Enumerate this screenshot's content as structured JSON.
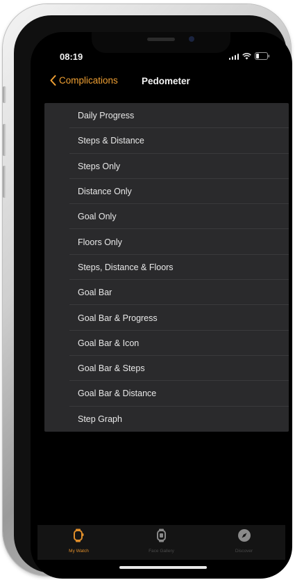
{
  "status_bar": {
    "time": "08:19"
  },
  "nav": {
    "back_label": "Complications",
    "title": "Pedometer",
    "accent": "#f0a033"
  },
  "list": {
    "items": [
      {
        "label": "Daily Progress"
      },
      {
        "label": "Steps & Distance"
      },
      {
        "label": "Steps Only"
      },
      {
        "label": "Distance Only"
      },
      {
        "label": "Goal Only"
      },
      {
        "label": "Floors Only"
      },
      {
        "label": "Steps, Distance & Floors"
      },
      {
        "label": "Goal Bar"
      },
      {
        "label": "Goal Bar & Progress"
      },
      {
        "label": "Goal Bar & Icon"
      },
      {
        "label": "Goal Bar & Steps"
      },
      {
        "label": "Goal Bar & Distance"
      },
      {
        "label": "Step Graph"
      }
    ]
  },
  "tab_bar": {
    "tabs": [
      {
        "label": "My Watch",
        "icon": "watch-icon",
        "active": true
      },
      {
        "label": "Face Gallery",
        "icon": "face-gallery-icon",
        "active": false
      },
      {
        "label": "Discover",
        "icon": "compass-icon",
        "active": false
      }
    ],
    "active_color": "#e08e2a"
  }
}
